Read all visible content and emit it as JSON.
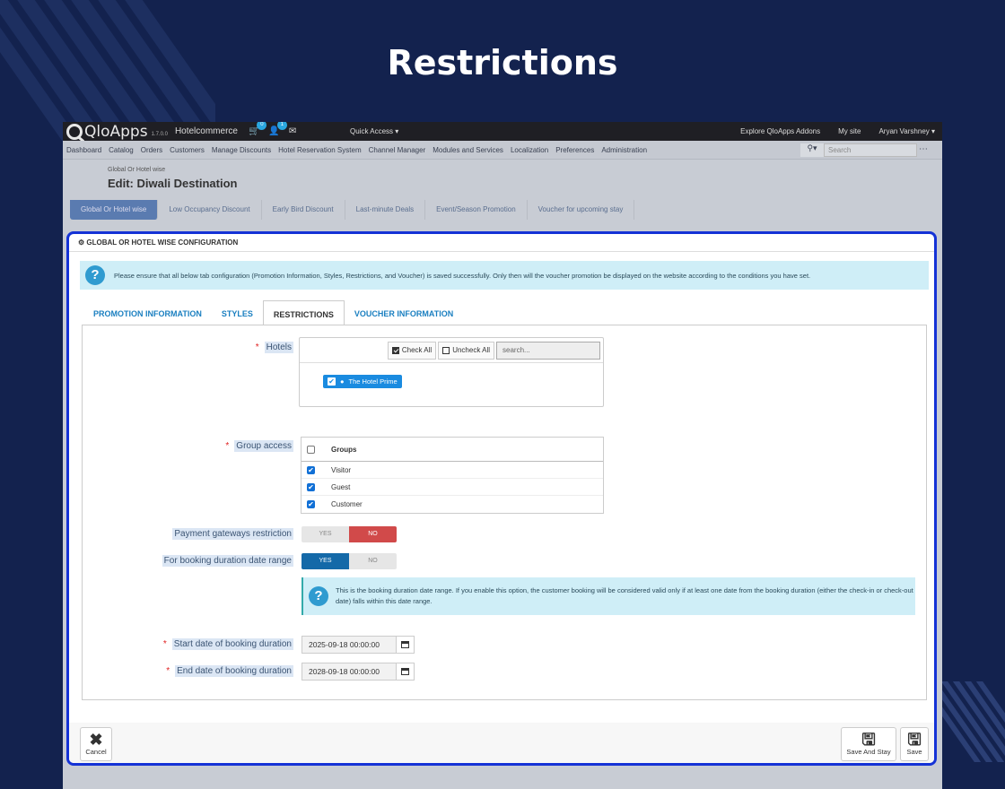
{
  "hero_title": "Restrictions",
  "topbar": {
    "brand": "QloApps",
    "version": "1.7.0.0",
    "shop": "Hotelcommerce",
    "cart_badge": "0",
    "customer_badge": "1",
    "quick_access": "Quick Access ▾",
    "explore": "Explore QloApps Addons",
    "my_site": "My site",
    "user": "Aryan Varshney ▾"
  },
  "nav": {
    "items": [
      "Dashboard",
      "Catalog",
      "Orders",
      "Customers",
      "Manage Discounts",
      "Hotel Reservation System",
      "Channel Manager",
      "Modules and Services",
      "Localization",
      "Preferences",
      "Administration"
    ],
    "search_placeholder": "Search"
  },
  "header": {
    "breadcrumb": "Global Or Hotel wise",
    "title": "Edit: Diwali Destination"
  },
  "config_tabs": [
    "Global Or Hotel wise",
    "Low Occupancy Discount",
    "Early Bird Discount",
    "Last-minute Deals",
    "Event/Season Promotion",
    "Voucher for upcoming stay"
  ],
  "panel": {
    "heading": "GLOBAL OR HOTEL WISE CONFIGURATION",
    "alert": "Please ensure that all below tab configuration (Promotion Information, Styles, Restrictions, and Voucher) is saved successfully. Only then will the voucher promotion be displayed on the website according to the conditions you have set.",
    "tabs": [
      "PROMOTION INFORMATION",
      "STYLES",
      "RESTRICTIONS",
      "VOUCHER INFORMATION"
    ],
    "active_tab": "RESTRICTIONS"
  },
  "form": {
    "hotels_label": "Hotels",
    "check_all": "Check All",
    "uncheck_all": "Uncheck All",
    "hotel_search_placeholder": "search...",
    "hotel_selected": "The Hotel Prime",
    "group_label": "Group access",
    "groups_header": "Groups",
    "groups": [
      "Visitor",
      "Guest",
      "Customer"
    ],
    "payment_label": "Payment gateways restriction",
    "payment_value": "NO",
    "booking_range_label": "For booking duration date range",
    "booking_range_value": "YES",
    "yes": "YES",
    "no": "NO",
    "booking_info": "This is the booking duration date range. If you enable this option, the customer booking will be considered valid only if at least one date from the booking duration (either the check-in or check-out date) falls within this date range.",
    "start_label": "Start date of booking duration",
    "start_value": "2025-09-18 00:00:00",
    "end_label": "End date of booking duration",
    "end_value": "2028-09-18 00:00:00"
  },
  "footer": {
    "cancel": "Cancel",
    "save_and_stay": "Save And Stay",
    "save": "Save"
  },
  "colors": {
    "background": "#13224e",
    "panel_border": "#1432d6",
    "toggle_no": "#d14a4a",
    "toggle_yes": "#1469a8",
    "info_bg": "#cfeef7"
  }
}
